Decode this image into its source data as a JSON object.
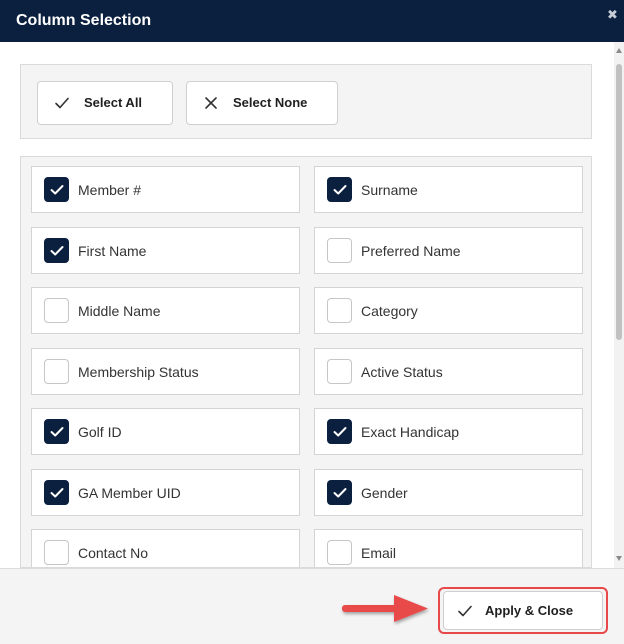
{
  "dialog": {
    "title": "Column Selection",
    "close_icon": "close-icon"
  },
  "toolbar": {
    "select_all_label": "Select All",
    "select_none_label": "Select None"
  },
  "columns": [
    {
      "label": "Member #",
      "checked": true
    },
    {
      "label": "Surname",
      "checked": true
    },
    {
      "label": "First Name",
      "checked": true
    },
    {
      "label": "Preferred Name",
      "checked": false
    },
    {
      "label": "Middle Name",
      "checked": false
    },
    {
      "label": "Category",
      "checked": false
    },
    {
      "label": "Membership Status",
      "checked": false
    },
    {
      "label": "Active Status",
      "checked": false
    },
    {
      "label": "Golf ID",
      "checked": true
    },
    {
      "label": "Exact Handicap",
      "checked": true
    },
    {
      "label": "GA Member UID",
      "checked": true
    },
    {
      "label": "Gender",
      "checked": true
    },
    {
      "label": "Contact No",
      "checked": false
    },
    {
      "label": "Email",
      "checked": false
    }
  ],
  "footer": {
    "apply_label": "Apply & Close"
  },
  "colors": {
    "header_bg": "#0b1f3f",
    "checkbox_checked": "#0b1f3f",
    "annotation_red": "#e8484a"
  }
}
